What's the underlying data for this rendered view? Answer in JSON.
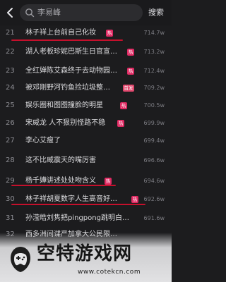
{
  "search": {
    "query": "李易峰",
    "button_label": "搜索"
  },
  "rows": [
    {
      "rank": "21",
      "title": "林子祥上台前自己化妆",
      "badge": "热",
      "heat": "714.7w"
    },
    {
      "rank": "22",
      "title": "湖人老板珍妮巴斯生日官宣…",
      "badge": "热",
      "heat": "713.2w"
    },
    {
      "rank": "23",
      "title": "全红婵陈艾森终于去动物园…",
      "badge": "热",
      "heat": "712.4w"
    },
    {
      "rank": "24",
      "title": "被邓刚野河钓鱼捡垃圾整…",
      "badge": "首发",
      "heat": "709.2w"
    },
    {
      "rank": "25",
      "title": "娱乐圈和图图撞脸的明星",
      "badge": "热",
      "heat": "700.5w"
    },
    {
      "rank": "26",
      "title": "宋威龙 人不狠别怪路不稳",
      "badge": "热",
      "heat": "699.9w"
    },
    {
      "rank": "27",
      "title": "李心艾瘦了",
      "badge": "",
      "heat": "699.4w"
    },
    {
      "rank": "28",
      "title": "这不比威震天的嘴厉害",
      "badge": "",
      "heat": "696.6w"
    },
    {
      "rank": "29",
      "title": "杨千嬅讲述处处吻含义",
      "badge": "热",
      "heat": "694.6w"
    },
    {
      "rank": "30",
      "title": "林子祥胡夏数字人生高音好…",
      "badge": "热",
      "heat": "692.6w"
    },
    {
      "rank": "31",
      "title": "孙滢皓刘隽把pingpong跳明白…",
      "badge": "",
      "heat": "691.6w"
    },
    {
      "rank": "32",
      "title": "西多洲间谍严加拿大公民限…",
      "badge": "",
      "heat": ""
    }
  ],
  "watermark": {
    "title": "空特游戏网",
    "url": "www.cotekcn.com"
  },
  "colors": {
    "hot_badge": "#e02a63",
    "underline": "#c5102c",
    "background": "#1c1c1e"
  }
}
